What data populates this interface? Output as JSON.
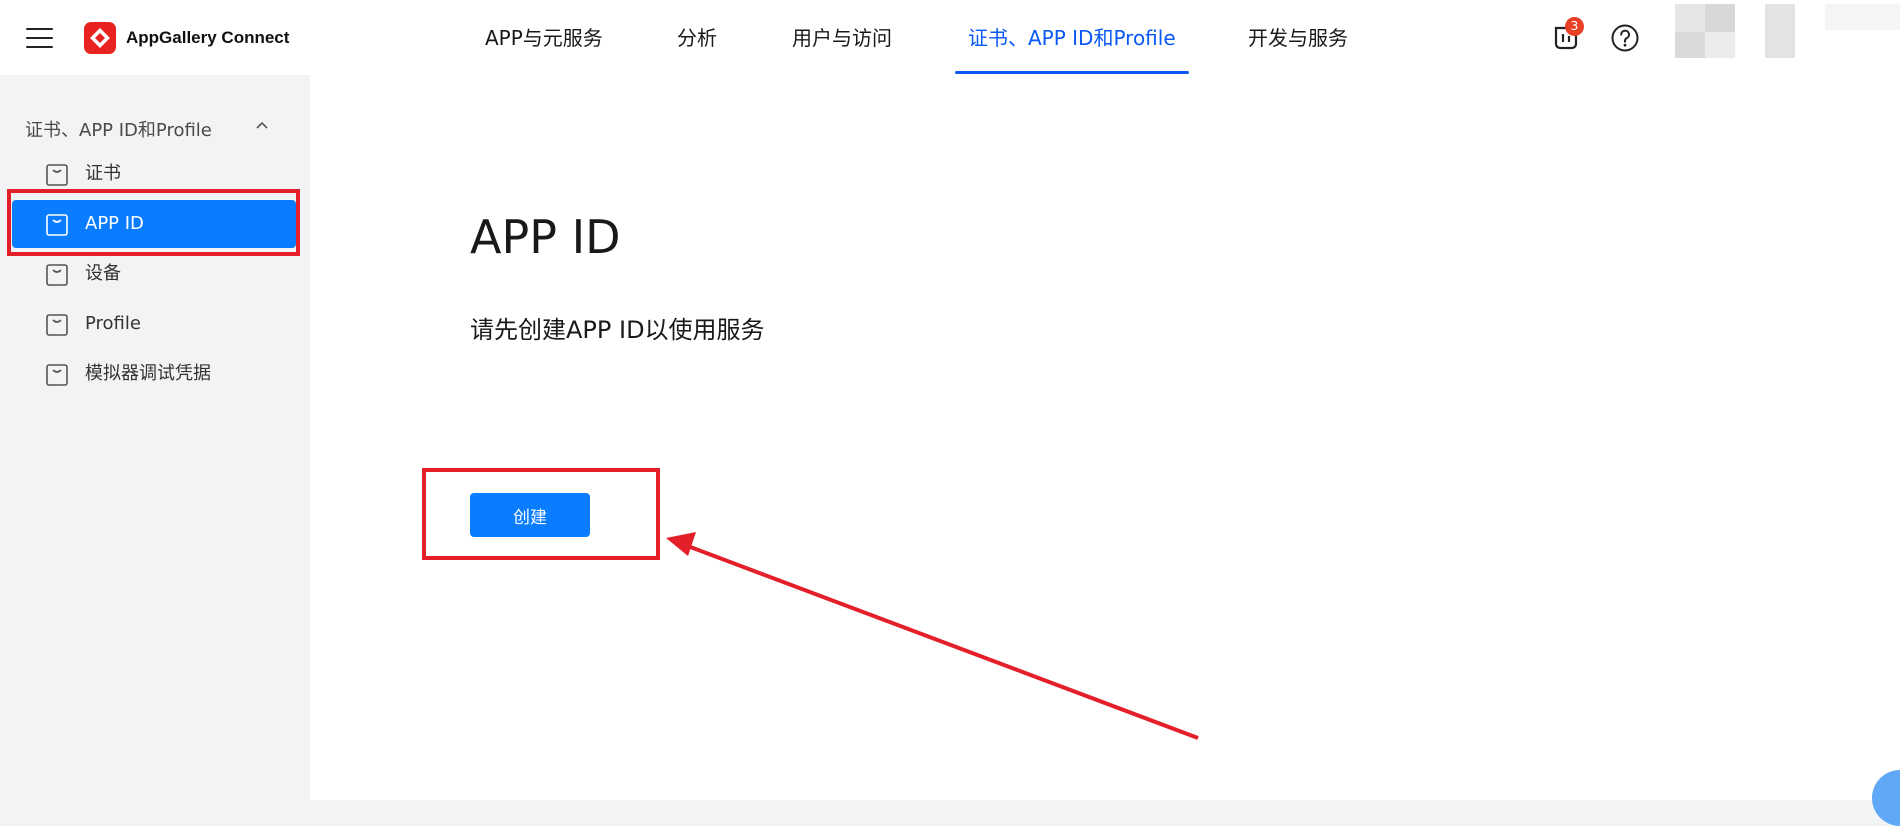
{
  "app": {
    "brand": "AppGallery Connect",
    "logo_icon": "huawei-appgallery-logo-icon",
    "brand_color": "#e8231f",
    "accent_color": "#0a59f7"
  },
  "header": {
    "menu_icon": "hamburger-menu-icon",
    "nav": [
      {
        "label": "APP与元服务",
        "active": false
      },
      {
        "label": "分析",
        "active": false
      },
      {
        "label": "用户与访问",
        "active": false
      },
      {
        "label": "证书、APP ID和Profile",
        "active": true
      },
      {
        "label": "开发与服务",
        "active": false
      }
    ],
    "notification_icon": "notification-icon",
    "notification_count": "3",
    "help_icon": "help-circle-icon"
  },
  "sidebar": {
    "group_title": "证书、APP ID和Profile",
    "group_chevron_icon": "chevron-up-icon",
    "items": [
      {
        "label": "证书",
        "icon": "item-box-icon",
        "active": false
      },
      {
        "label": "APP ID",
        "icon": "item-box-icon",
        "active": true
      },
      {
        "label": "设备",
        "icon": "item-box-icon",
        "active": false
      },
      {
        "label": "Profile",
        "icon": "item-box-icon",
        "active": false
      },
      {
        "label": "模拟器调试凭据",
        "icon": "item-box-icon",
        "active": false
      }
    ]
  },
  "main": {
    "heading": "APP ID",
    "description": "请先创建APP ID以使用服务",
    "create_button": "创建"
  },
  "annotations": {
    "highlight_color": "#e3202a"
  }
}
